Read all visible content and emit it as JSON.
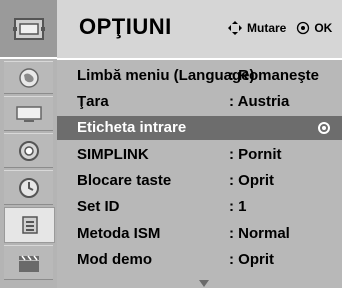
{
  "header": {
    "title": "OPŢIUNI",
    "hint_move": "Mutare",
    "hint_ok": "OK"
  },
  "sidebar": {
    "items": [
      {
        "icon": "settings-menu-icon"
      },
      {
        "icon": "globe-icon"
      },
      {
        "icon": "picture-icon"
      },
      {
        "icon": "audio-icon"
      },
      {
        "icon": "time-icon"
      },
      {
        "icon": "option-icon",
        "active": true
      },
      {
        "icon": "movie-clapper-icon"
      }
    ]
  },
  "menu": {
    "items": [
      {
        "label": "Limbă meniu (Language)",
        "value": ": Romaneşte"
      },
      {
        "label": "Ţara",
        "value": ": Austria"
      },
      {
        "label": "Eticheta intrare",
        "value": "",
        "selected": true
      },
      {
        "label": "SIMPLINK",
        "value": ": Pornit"
      },
      {
        "label": "Blocare taste",
        "value": ": Oprit"
      },
      {
        "label": "Set ID",
        "value": ": 1"
      },
      {
        "label": "Metoda ISM",
        "value": ": Normal"
      },
      {
        "label": "Mod demo",
        "value": ": Oprit"
      }
    ]
  }
}
